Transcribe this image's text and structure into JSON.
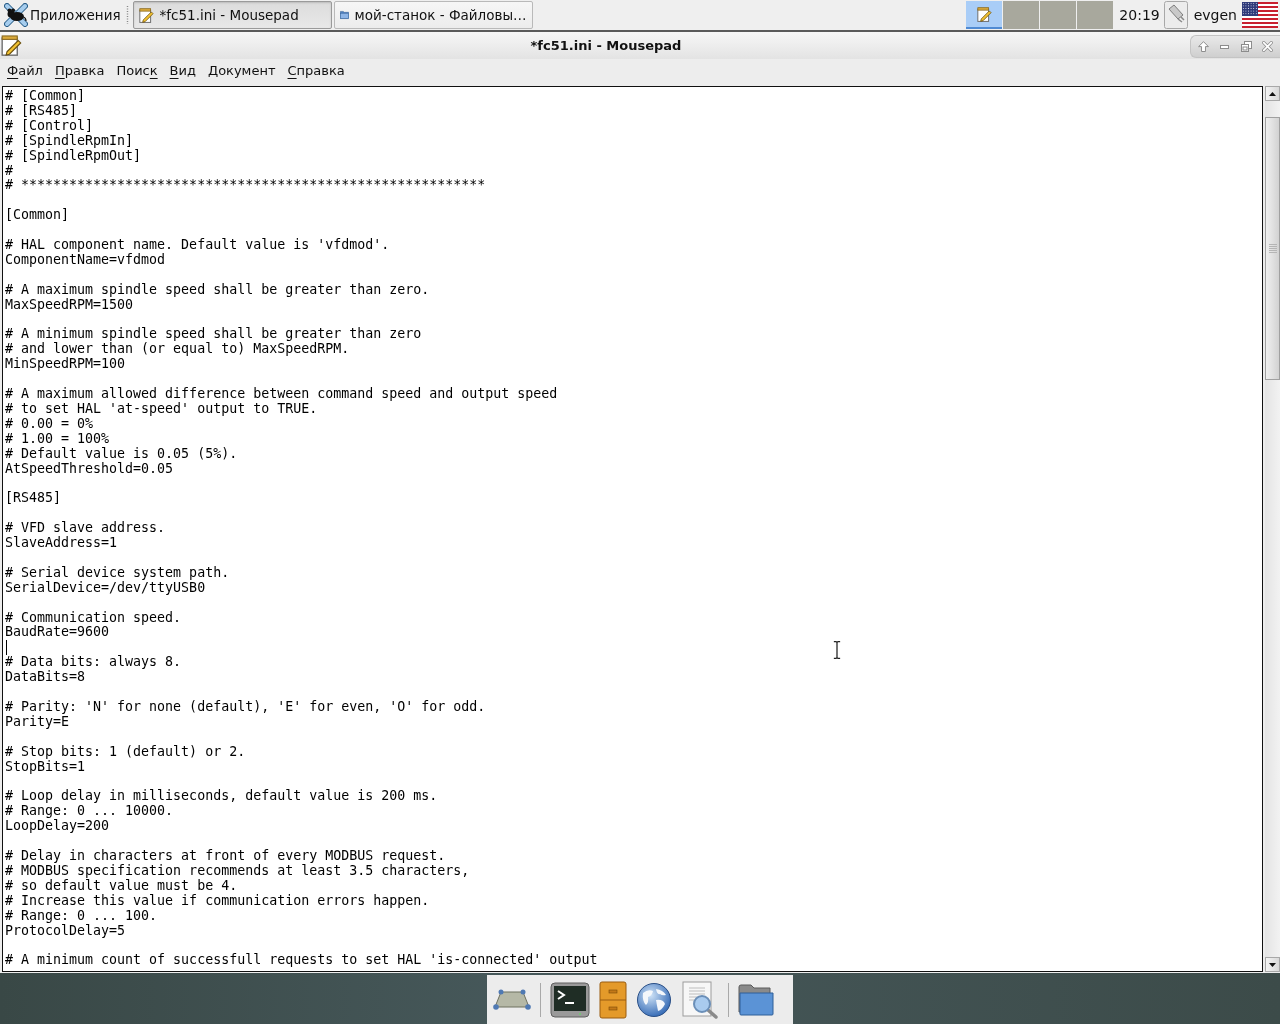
{
  "top_panel": {
    "apps_menu": {
      "label": "Приложения"
    },
    "tasks": [
      {
        "title": "*fc51.ini - Mousepad",
        "kind": "editor",
        "selected": true
      },
      {
        "title": "мой-станок - Файловы…",
        "kind": "folder",
        "selected": false
      }
    ],
    "workspaces": [
      {
        "selected": true,
        "app_icon": true
      },
      {
        "selected": false,
        "app_icon": false
      },
      {
        "selected": false,
        "app_icon": false
      },
      {
        "selected": false,
        "app_icon": false
      }
    ],
    "clock": "20:19",
    "user": "evgen"
  },
  "window": {
    "title": "*fc51.ini - Mousepad"
  },
  "menu": [
    {
      "label": "Файл",
      "underline_first": true,
      "underline_last": false
    },
    {
      "label": "Правка",
      "underline_first": true,
      "underline_last": false
    },
    {
      "label": "Поиск",
      "underline_first": false,
      "underline_last": true
    },
    {
      "label": "Вид",
      "underline_first": true,
      "underline_last": false
    },
    {
      "label": "Документ",
      "underline_first": false,
      "underline_last": false
    },
    {
      "label": "Справка",
      "underline_first": true,
      "underline_last": false
    }
  ],
  "editor": {
    "blocks": [
      {
        "lines": [
          "# [Common]",
          "# [RS485]",
          "# [Control]",
          "# [SpindleRpmIn]",
          "# [SpindleRpmOut]",
          "#",
          "# **********************************************************"
        ],
        "caret_after": false
      },
      {
        "lines": [
          "[Common]"
        ],
        "caret_after": false
      },
      {
        "lines": [
          "# HAL component name. Default value is 'vfdmod'.",
          "ComponentName=vfdmod"
        ],
        "caret_after": false
      },
      {
        "lines": [
          "# A maximum spindle speed shall be greater than zero.",
          "MaxSpeedRPM=1500"
        ],
        "caret_after": false
      },
      {
        "lines": [
          "# A minimum spindle speed shall be greater than zero",
          "# and lower than (or equal to) MaxSpeedRPM.",
          "MinSpeedRPM=100"
        ],
        "caret_after": false
      },
      {
        "lines": [
          "# A maximum allowed difference between command speed and output speed",
          "# to set HAL 'at-speed' output to TRUE.",
          "# 0.00 = 0%",
          "# 1.00 = 100%",
          "# Default value is 0.05 (5%).",
          "AtSpeedThreshold=0.05"
        ],
        "caret_after": false
      },
      {
        "lines": [
          "[RS485]"
        ],
        "caret_after": false
      },
      {
        "lines": [
          "# VFD slave address.",
          "SlaveAddress=1"
        ],
        "caret_after": false
      },
      {
        "lines": [
          "# Serial device system path.",
          "SerialDevice=/dev/ttyUSB0"
        ],
        "caret_after": false
      },
      {
        "lines": [
          "# Communication speed.",
          "BaudRate=9600"
        ],
        "caret_after": true
      },
      {
        "lines": [
          "# Data bits: always 8.",
          "DataBits=8"
        ],
        "caret_after": false
      },
      {
        "lines": [
          "# Parity: 'N' for none (default), 'E' for even, 'O' for odd.",
          "Parity=E"
        ],
        "caret_after": false
      },
      {
        "lines": [
          "# Stop bits: 1 (default) or 2.",
          "StopBits=1"
        ],
        "caret_after": false
      },
      {
        "lines": [
          "# Loop delay in milliseconds, default value is 200 ms.",
          "# Range: 0 ... 10000.",
          "LoopDelay=200"
        ],
        "caret_after": false
      },
      {
        "lines": [
          "# Delay in characters at front of every MODBUS request.",
          "# MODBUS specification recommends at least 3.5 characters,",
          "# so default value must be 4.",
          "# Increase this value if communication errors happen.",
          "# Range: 0 ... 100.",
          "ProtocolDelay=5"
        ],
        "caret_after": false
      },
      {
        "lines": [
          "# A minimum count of successfull requests to set HAL 'is-connected' output"
        ],
        "caret_after": false
      }
    ]
  }
}
